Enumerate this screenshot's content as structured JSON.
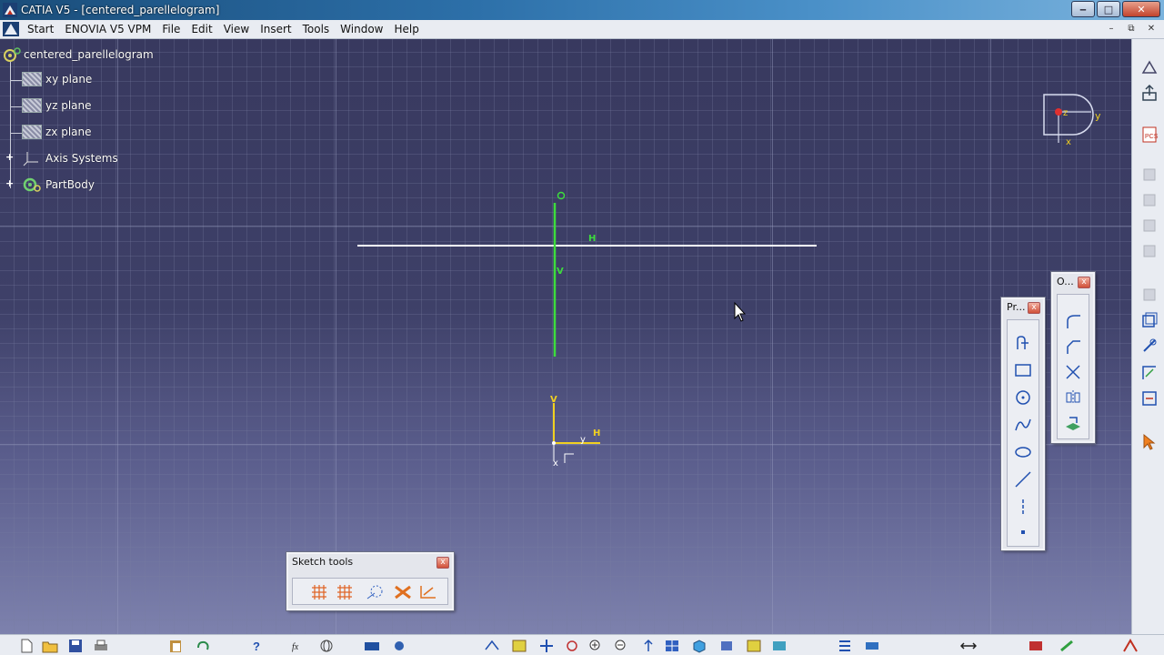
{
  "window": {
    "title": "CATIA V5 - [centered_parellelogram]",
    "minimize": "‒",
    "maximize": "□",
    "close": "✕"
  },
  "menubar": {
    "items": [
      "Start",
      "ENOVIA V5 VPM",
      "File",
      "Edit",
      "View",
      "Insert",
      "Tools",
      "Window",
      "Help"
    ],
    "mdi_minimize": "–",
    "mdi_restore": "⧉",
    "mdi_close": "✕"
  },
  "tree": {
    "root": "centered_parellelogram",
    "items": [
      "xy plane",
      "yz plane",
      "zx plane",
      "Axis Systems",
      "PartBody"
    ],
    "expand_symbol": "+"
  },
  "sketch": {
    "origin_label": "O",
    "h_label": "H",
    "v_label": "V",
    "axis_y": "y",
    "axis_x": "x",
    "axis_h": "H",
    "axis_v": "V"
  },
  "compass": {
    "z": "z",
    "y": "y",
    "x": "x"
  },
  "palettes": {
    "sketch_tools": {
      "title": "Sketch tools",
      "close": "x"
    },
    "profile": {
      "title": "Pr...",
      "close": "x"
    },
    "operation": {
      "title": "O...",
      "close": "x"
    }
  },
  "colors": {
    "viewport_top": "#38395f",
    "axis_green": "#3ddc3d",
    "axis_yellow": "#f0d020",
    "line_white": "#ffffff"
  }
}
